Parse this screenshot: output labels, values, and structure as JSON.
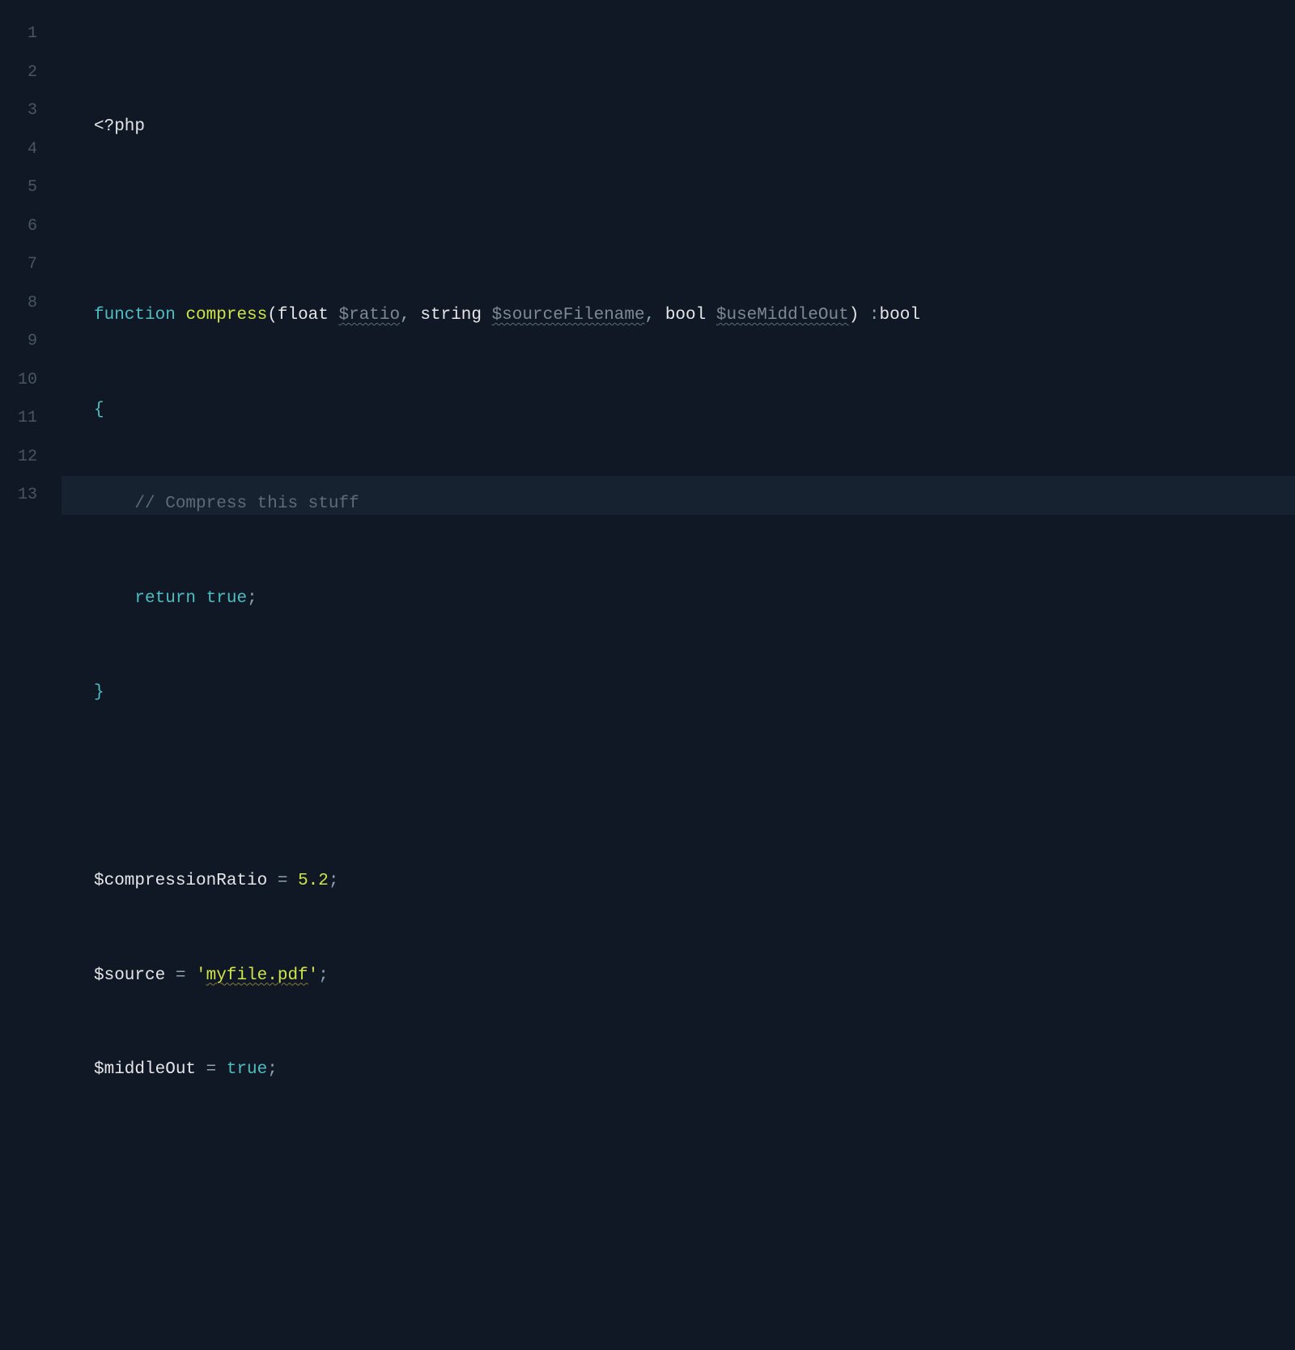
{
  "editor": {
    "line_count": 13,
    "current_line": 13,
    "lines": {
      "l1_phptag": "<?php",
      "l3": {
        "kw_function": "function",
        "fn_name": "compress",
        "lparen": "(",
        "p1_type": "float",
        "p1_var": "$ratio",
        "c1": ",",
        "p2_type": "string",
        "p2_var": "$sourceFilename",
        "c2": ",",
        "p3_type": "bool",
        "p3_var": "$useMiddleOut",
        "rparen": ")",
        "ret_colon": " :",
        "ret_type": "bool"
      },
      "l4_brace": "{",
      "l5_comment": "// Compress this stuff",
      "l6": {
        "kw_return": "return",
        "kw_true": "true",
        "semi": ";"
      },
      "l7_brace": "}",
      "l9": {
        "var": "$compressionRatio",
        "eq": " = ",
        "val": "5.2",
        "semi": ";"
      },
      "l10": {
        "var": "$source",
        "eq": " = ",
        "q1": "'",
        "val": "myfile.pdf",
        "q2": "'",
        "semi": ";"
      },
      "l11": {
        "var": "$middleOut",
        "eq": " = ",
        "val": "true",
        "semi": ";"
      }
    }
  }
}
